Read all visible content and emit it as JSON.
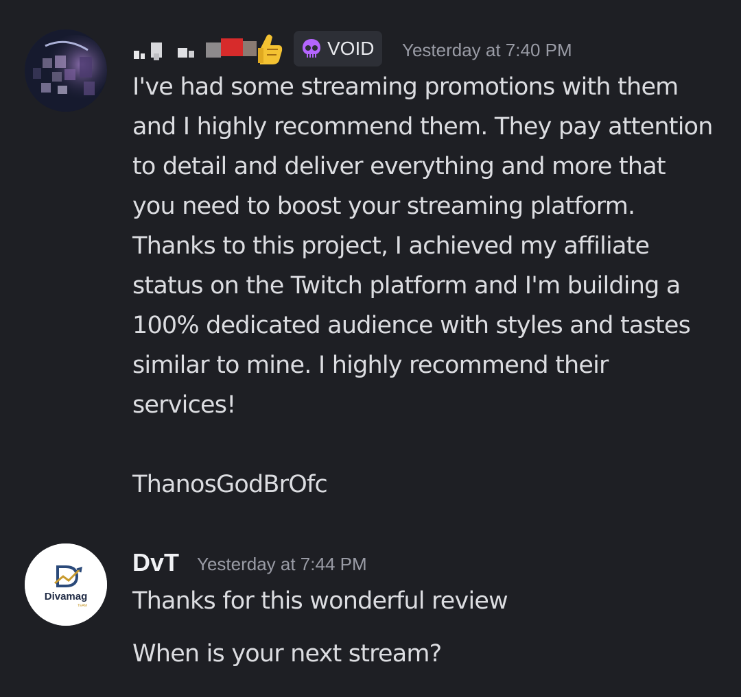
{
  "messages": [
    {
      "author_badge": "VOID",
      "timestamp": "Yesterday at 7:40 PM",
      "body": "I've had some streaming promotions with them\nand I highly recommend them. They pay attention\nto detail and deliver everything and more that\nyou need to boost your streaming platform.\nThanks to this project, I achieved my affiliate\nstatus on the Twitch platform and I'm building a\n100% dedicated audience with styles and tastes\nsimilar to mine. I highly recommend their\nservices!",
      "signature": "ThanosGodBrOfc",
      "avatar_icon": "blurred-avatar-icon",
      "badge_icon": "purple-skull-icon",
      "username_icon": "thumbs-up-emoji-icon"
    },
    {
      "author": "DvT",
      "timestamp": "Yesterday at 7:44 PM",
      "body": "Thanks for this wonderful review",
      "body2": "When is your next stream?",
      "avatar_logo_text": "Divamag",
      "avatar_logo_subtext": "TEAM",
      "avatar_icon": "divamag-logo-icon"
    }
  ],
  "colors": {
    "background": "#1e1f24",
    "badge_bg": "#2d2f36",
    "timestamp": "#9a9ca6",
    "text": "#dcdde1",
    "badge_icon": "#b565ff"
  }
}
